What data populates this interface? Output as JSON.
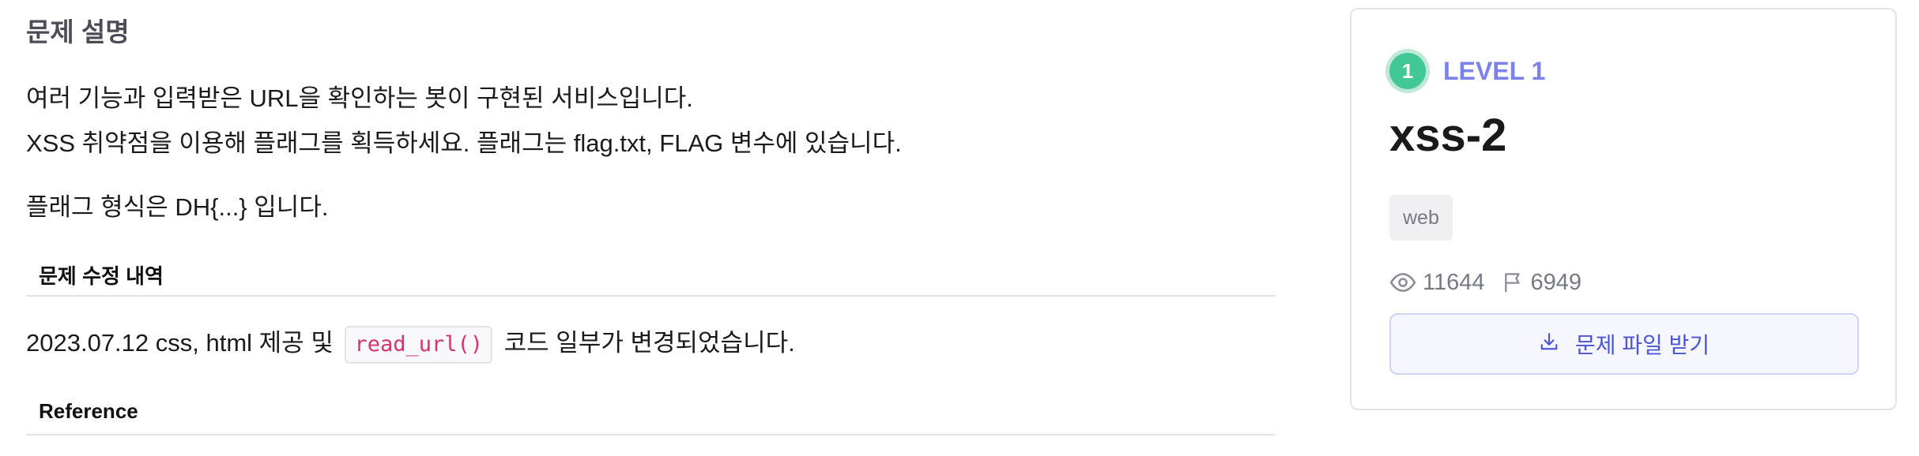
{
  "description": {
    "section_title": "문제 설명",
    "line1": "여러 기능과 입력받은 URL을 확인하는 봇이 구현된 서비스입니다.",
    "line2": "XSS 취약점을 이용해 플래그를 획득하세요. 플래그는 flag.txt, FLAG 변수에 있습니다.",
    "line3": "플래그 형식은 DH{...} 입니다.",
    "history_heading": "문제 수정 내역",
    "history_prefix": "2023.07.12 css, html 제공 및",
    "history_code": "read_url()",
    "history_suffix": "코드 일부가 변경되었습니다.",
    "reference_heading": "Reference"
  },
  "card": {
    "level_number": "1",
    "level_label": "LEVEL 1",
    "title": "xss-2",
    "tag": "web",
    "views": "11644",
    "solves": "6949",
    "download_label": "문제 파일 받기",
    "icons": {
      "views": "eye-icon",
      "solves": "flag-icon",
      "download": "download-icon"
    }
  },
  "colors": {
    "accent": "#7b82e8",
    "level_badge": "#42c796",
    "code_text": "#d6336c",
    "button_text": "#4b55d6"
  }
}
